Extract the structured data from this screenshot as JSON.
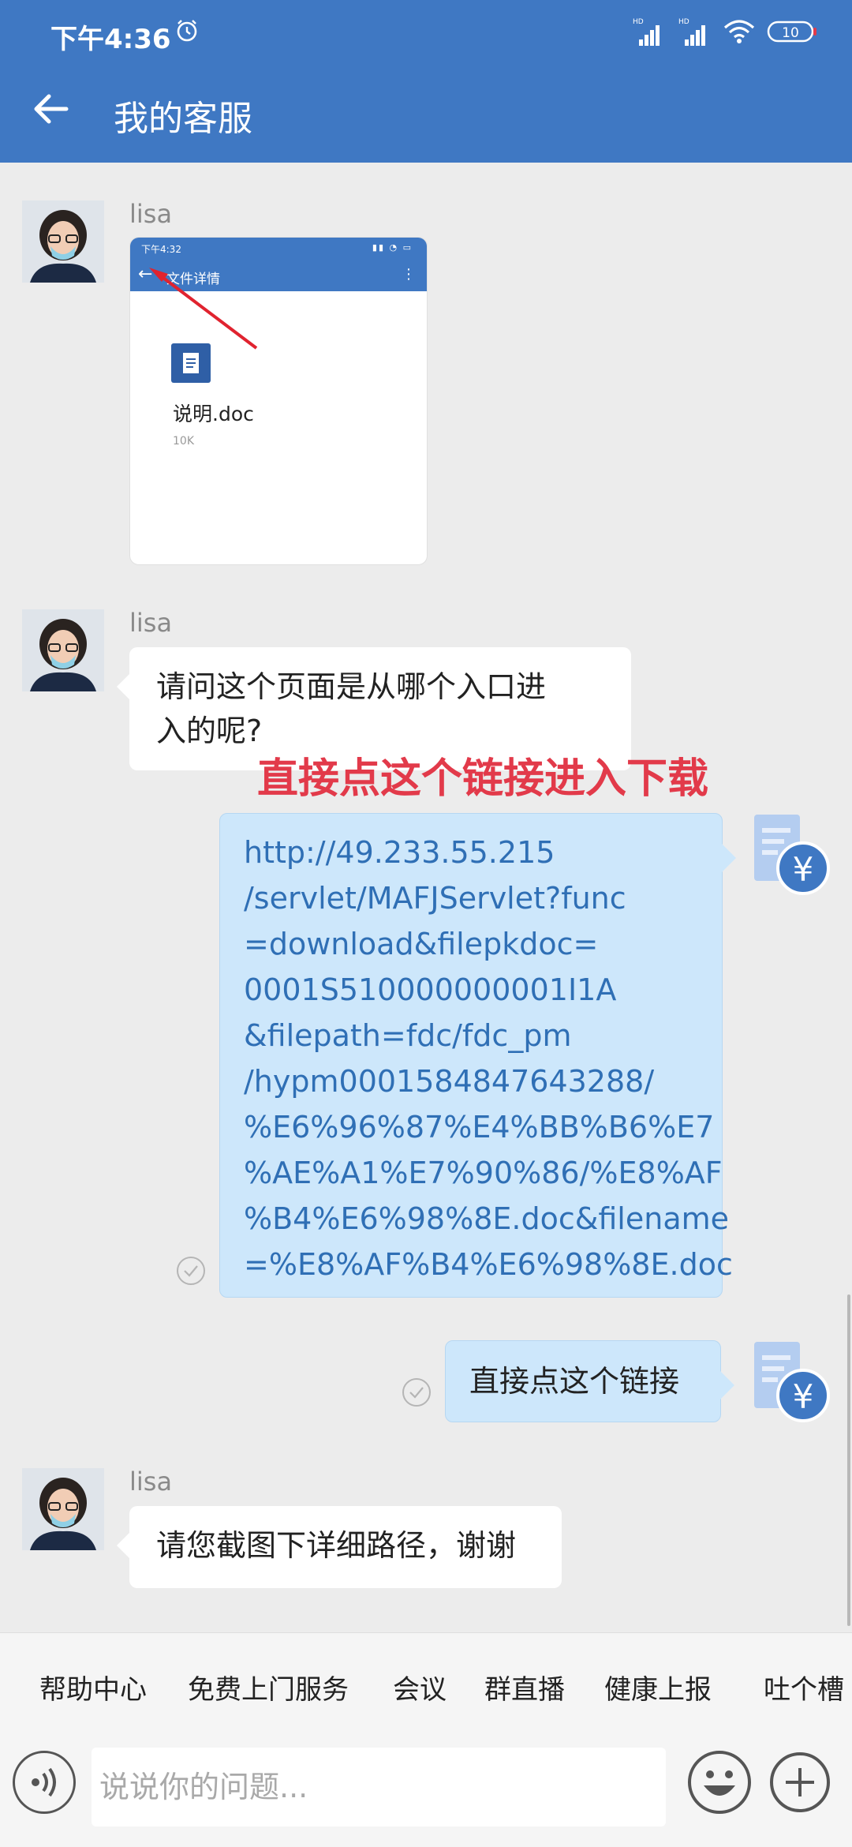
{
  "status_bar": {
    "time": "下午4:36",
    "signal1_label": "HD",
    "signal2_label": "HD",
    "battery": "10"
  },
  "app_bar": {
    "title": "我的客服"
  },
  "messages": [
    {
      "sender": "lisa",
      "type": "image",
      "image": {
        "time": "下午4:32",
        "title": "文件详情",
        "file_name": "说明.doc",
        "file_size": "10K"
      }
    },
    {
      "sender": "lisa",
      "type": "text",
      "lines": [
        "请问这个页面是从哪个入口进",
        "入的呢?"
      ]
    },
    {
      "sender": "me",
      "type": "link",
      "lines": [
        "http://49.233.55.215",
        "/servlet/MAFJServlet?func",
        "=download&filepkdoc=",
        "0001S510000000001I1A",
        "&filepath=fdc/fdc_pm",
        "/hypm0001584847643288/",
        "%E6%96%87%E4%BB%B6%E7",
        "%AE%A1%E7%90%86/%E8%AF",
        "%B4%E6%98%8E.doc&filename",
        "=%E8%AF%B4%E6%98%8E.doc"
      ]
    },
    {
      "sender": "me",
      "type": "text",
      "text": "直接点这个链接"
    },
    {
      "sender": "lisa",
      "type": "text",
      "text": "请您截图下详细路径，谢谢"
    }
  ],
  "annotation": "直接点这个链接进入下载",
  "quick_actions": [
    "帮助中心",
    "免费上门服务",
    "会议",
    "群直播",
    "健康上报",
    "吐个槽"
  ],
  "input": {
    "placeholder": "说说你的问题..."
  },
  "colors": {
    "app_bar": "#3f78c3",
    "link_text": "#2f6fb5",
    "my_bubble": "#cde7fb",
    "annotation": "#e23a4a"
  },
  "icons": [
    "alarm-icon",
    "signal-icon",
    "wifi-icon",
    "battery-icon",
    "back-arrow-icon",
    "read-check-icon",
    "service-avatar-icon",
    "voice-icon",
    "emoji-icon",
    "plus-icon"
  ]
}
